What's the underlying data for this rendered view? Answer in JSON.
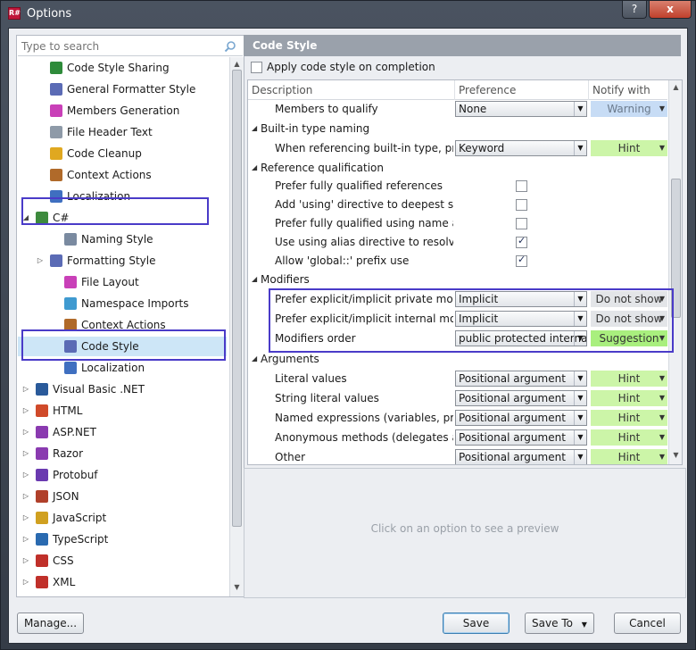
{
  "window": {
    "title": "Options",
    "help": "?",
    "close": "x"
  },
  "search": {
    "placeholder": "Type to search"
  },
  "tree": [
    {
      "label": "Code Style Sharing",
      "color": "#2e8b3a"
    },
    {
      "label": "General Formatter Style",
      "color": "#5b6bb5"
    },
    {
      "label": "Members Generation",
      "color": "#c940b8"
    },
    {
      "label": "File Header Text",
      "color": "#8e9aa8"
    },
    {
      "label": "Code Cleanup",
      "color": "#e0a820"
    },
    {
      "label": "Context Actions",
      "color": "#b06a2a"
    },
    {
      "label": "Localization",
      "color": "#3f6fc0"
    },
    {
      "label": "C#",
      "color": "#3d8a3d",
      "expander": "◢"
    },
    {
      "label": "Naming Style",
      "color": "#7a8aa0"
    },
    {
      "label": "Formatting Style",
      "color": "#5b6bb5",
      "expander": "▷"
    },
    {
      "label": "File Layout",
      "color": "#c940b8"
    },
    {
      "label": "Namespace Imports",
      "color": "#3f9ad0"
    },
    {
      "label": "Context Actions",
      "color": "#b06a2a"
    },
    {
      "label": "Code Style",
      "color": "#5b6bb5"
    },
    {
      "label": "Localization",
      "color": "#3f6fc0"
    },
    {
      "label": "Visual Basic .NET",
      "color": "#2a5a9a",
      "expander": "▷"
    },
    {
      "label": "HTML",
      "color": "#d04a2a",
      "expander": "▷"
    },
    {
      "label": "ASP.NET",
      "color": "#8a3ab0",
      "expander": "▷"
    },
    {
      "label": "Razor",
      "color": "#8a3ab0",
      "expander": "▷"
    },
    {
      "label": "Protobuf",
      "color": "#6a3ab0",
      "expander": "▷"
    },
    {
      "label": "JSON",
      "color": "#b0402a",
      "expander": "▷"
    },
    {
      "label": "JavaScript",
      "color": "#d0a020",
      "expander": "▷"
    },
    {
      "label": "TypeScript",
      "color": "#2a6ab0",
      "expander": "▷"
    },
    {
      "label": "CSS",
      "color": "#c0302a",
      "expander": "▷"
    },
    {
      "label": "XML",
      "color": "#c0302a",
      "expander": "▷"
    }
  ],
  "panel": {
    "title": "Code Style",
    "apply_label": "Apply code style on completion",
    "columns": [
      "Description",
      "Preference",
      "Notify with"
    ],
    "preview_text": "Click on an option to see a preview"
  },
  "rows": [
    {
      "type": "item",
      "desc": "Members to qualify",
      "pref": "None",
      "notify": "Warning",
      "notify_style": "warning"
    },
    {
      "type": "group",
      "desc": "Built-in type naming"
    },
    {
      "type": "item",
      "desc": "When referencing built-in type, pref...",
      "pref": "Keyword",
      "notify": "Hint",
      "notify_style": "hint"
    },
    {
      "type": "group",
      "desc": "Reference qualification"
    },
    {
      "type": "check",
      "desc": "Prefer fully qualified references",
      "checked": false
    },
    {
      "type": "check",
      "desc": "Add 'using' directive to deepest sco...",
      "checked": false
    },
    {
      "type": "check",
      "desc": "Prefer fully qualified using name at...",
      "checked": false
    },
    {
      "type": "check",
      "desc": "Use using alias directive to resolve c...",
      "checked": true
    },
    {
      "type": "check",
      "desc": "Allow 'global::' prefix use",
      "checked": true
    },
    {
      "type": "group",
      "desc": "Modifiers"
    },
    {
      "type": "item",
      "desc": "Prefer explicit/implicit private modif...",
      "pref": "Implicit",
      "notify": "Do not show",
      "notify_style": "dns"
    },
    {
      "type": "item",
      "desc": "Prefer explicit/implicit internal modi...",
      "pref": "Implicit",
      "notify": "Do not show",
      "notify_style": "dns"
    },
    {
      "type": "item",
      "desc": "Modifiers order",
      "pref": "public protected internal",
      "notify": "Suggestion",
      "notify_style": "suggestion"
    },
    {
      "type": "group",
      "desc": "Arguments"
    },
    {
      "type": "item",
      "desc": "Literal values",
      "pref": "Positional argument",
      "notify": "Hint",
      "notify_style": "hint"
    },
    {
      "type": "item",
      "desc": "String literal values",
      "pref": "Positional argument",
      "notify": "Hint",
      "notify_style": "hint"
    },
    {
      "type": "item",
      "desc": "Named expressions (variables, prop...",
      "pref": "Positional argument",
      "notify": "Hint",
      "notify_style": "hint"
    },
    {
      "type": "item",
      "desc": "Anonymous methods (delegates an...",
      "pref": "Positional argument",
      "notify": "Hint",
      "notify_style": "hint"
    },
    {
      "type": "item",
      "desc": "Other",
      "pref": "Positional argument",
      "notify": "Hint",
      "notify_style": "hint"
    }
  ],
  "buttons": {
    "manage": "Manage...",
    "save": "Save",
    "save_to": "Save To",
    "cancel": "Cancel"
  }
}
